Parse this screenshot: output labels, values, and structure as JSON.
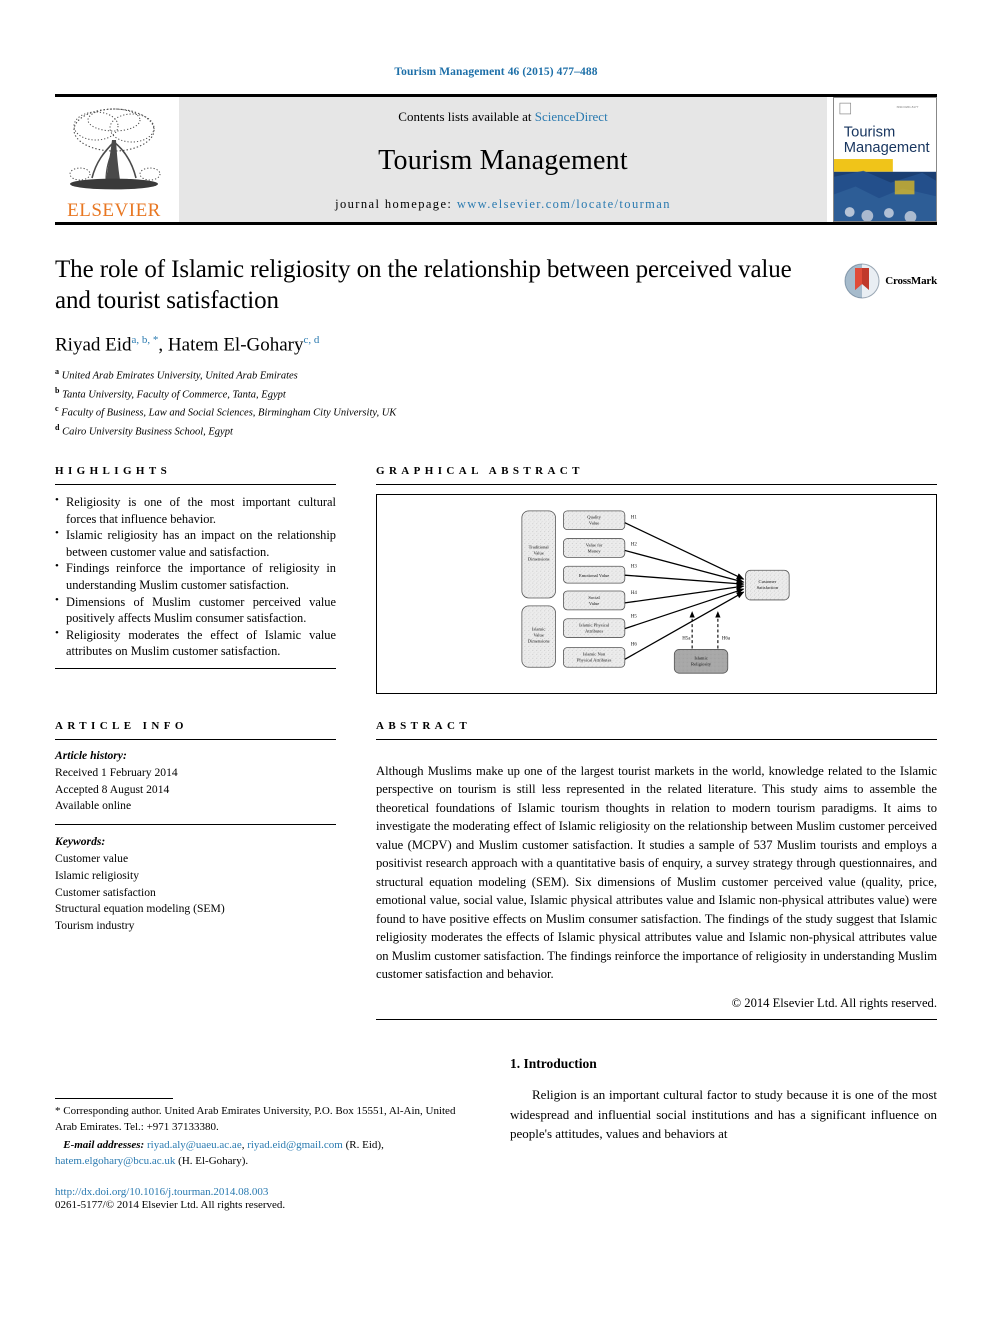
{
  "running_head": "Tourism Management 46 (2015) 477–488",
  "masthead": {
    "publisher": "ELSEVIER",
    "contents_prefix": "Contents lists available at ",
    "contents_link": "ScienceDirect",
    "journal_name": "Tourism Management",
    "homepage_prefix": "journal homepage: ",
    "homepage_url": "www.elsevier.com/locate/tourman",
    "cover_title_line1": "Tourism",
    "cover_title_line2": "Management"
  },
  "article": {
    "title": "The role of Islamic religiosity on the relationship between perceived value and tourist satisfaction",
    "authors_plain": "Riyad Eid ",
    "author1": "Riyad Eid",
    "author1_sup": "a, b, *",
    "author2": "Hatem El-Gohary",
    "author2_sup": "c, d",
    "affiliations": [
      {
        "marker": "a",
        "text": "United Arab Emirates University, United Arab Emirates"
      },
      {
        "marker": "b",
        "text": "Tanta University, Faculty of Commerce, Tanta, Egypt"
      },
      {
        "marker": "c",
        "text": "Faculty of Business, Law and Social Sciences, Birmingham City University, UK"
      },
      {
        "marker": "d",
        "text": "Cairo University Business School, Egypt"
      }
    ],
    "crossmark_label": "CrossMark"
  },
  "highlights": {
    "heading": "HIGHLIGHTS",
    "items": [
      "Religiosity is one of the most important cultural forces that influence behavior.",
      "Islamic religiosity has an impact on the relationship between customer value and satisfaction.",
      "Findings reinforce the importance of religiosity in understanding Muslim customer satisfaction.",
      "Dimensions of Muslim customer perceived value positively affects Muslim consumer satisfaction.",
      "Religiosity moderates the effect of Islamic value attributes on Muslim customer satisfaction."
    ]
  },
  "graphical_abstract": {
    "heading": "GRAPHICAL ABSTRACT",
    "diagram": {
      "groups": [
        {
          "name": "traditional-value-dimensions",
          "lines": [
            "Traditional",
            "Value",
            "Dimensions"
          ]
        },
        {
          "name": "islamic-value-dimensions",
          "lines": [
            "Islamic",
            "Value",
            "Dimensions"
          ]
        }
      ],
      "constructs": [
        {
          "name": "quality-value",
          "lines": [
            "Quality",
            "Value"
          ],
          "hypothesis": "H1"
        },
        {
          "name": "value-for-money",
          "lines": [
            "Value for",
            "Money"
          ],
          "hypothesis": "H2"
        },
        {
          "name": "emotional-value",
          "lines": [
            "Emotional Value"
          ],
          "hypothesis": "H3"
        },
        {
          "name": "social-value",
          "lines": [
            "Social",
            "Value"
          ],
          "hypothesis": "H4"
        },
        {
          "name": "islamic-physical-attributes",
          "lines": [
            "Islamic Physical",
            "Attributes"
          ],
          "hypothesis": "H5"
        },
        {
          "name": "islamic-non-physical-attributes",
          "lines": [
            "Islamic Non",
            "Physical Attributes"
          ],
          "hypothesis": "H6"
        }
      ],
      "outcome": {
        "name": "customer-satisfaction",
        "lines": [
          "Customer",
          "Satisfaction"
        ]
      },
      "moderator": {
        "name": "islamic-religiosity",
        "lines": [
          "Islamic",
          "Religiosity"
        ]
      },
      "moderation_paths": [
        "H5a",
        "H6a"
      ]
    }
  },
  "article_info": {
    "heading": "ARTICLE INFO",
    "history_label": "Article history:",
    "history": [
      "Received 1 February 2014",
      "Accepted 8 August 2014",
      "Available online"
    ],
    "keywords_label": "Keywords:",
    "keywords": [
      "Customer value",
      "Islamic religiosity",
      "Customer satisfaction",
      "Structural equation modeling (SEM)",
      "Tourism industry"
    ]
  },
  "abstract": {
    "heading": "ABSTRACT",
    "text": "Although Muslims make up one of the largest tourist markets in the world, knowledge related to the Islamic perspective on tourism is still less represented in the related literature. This study aims to assemble the theoretical foundations of Islamic tourism thoughts in relation to modern tourism paradigms. It aims to investigate the moderating effect of Islamic religiosity on the relationship between Muslim customer perceived value (MCPV) and Muslim customer satisfaction. It studies a sample of 537 Muslim tourists and employs a positivist research approach with a quantitative basis of enquiry, a survey strategy through questionnaires, and structural equation modeling (SEM). Six dimensions of Muslim customer perceived value (quality, price, emotional value, social value, Islamic physical attributes value and Islamic non-physical attributes value) were found to have positive effects on Muslim consumer satisfaction. The findings of the study suggest that Islamic religiosity moderates the effects of Islamic physical attributes value and Islamic non-physical attributes value on Muslim customer satisfaction. The findings reinforce the importance of religiosity in understanding Muslim customer satisfaction and behavior.",
    "copyright": "© 2014 Elsevier Ltd. All rights reserved."
  },
  "footnote": {
    "corresponding_marker": "*",
    "corresponding_text": "Corresponding author. United Arab Emirates University, P.O. Box 15551, Al-Ain, United Arab Emirates. Tel.: +971 37133380.",
    "email_label": "E-mail addresses:",
    "email1": "riyad.aly@uaeu.ac.ae",
    "email2": "riyad.eid@gmail.com",
    "email_attrib1": "(R. Eid)",
    "email3a": "hatem.",
    "email3b": "elgohary@bcu.ac.uk",
    "email_attrib2": "(H. El-Gohary)."
  },
  "doi": "http://dx.doi.org/10.1016/j.tourman.2014.08.003",
  "issn_line": "0261-5177/© 2014 Elsevier Ltd. All rights reserved.",
  "introduction": {
    "heading": "1. Introduction",
    "paragraph": "Religion is an important cultural factor to study because it is one of the most widespread and influential social institutions and has a significant influence on people's attitudes, values and behaviors at"
  },
  "colors": {
    "link": "#2a7ab0",
    "elsevier_orange": "#E87722",
    "masthead_bg": "#e6e6e6",
    "cover_blue": "#1b3f73",
    "cover_yellow": "#f0c419"
  }
}
